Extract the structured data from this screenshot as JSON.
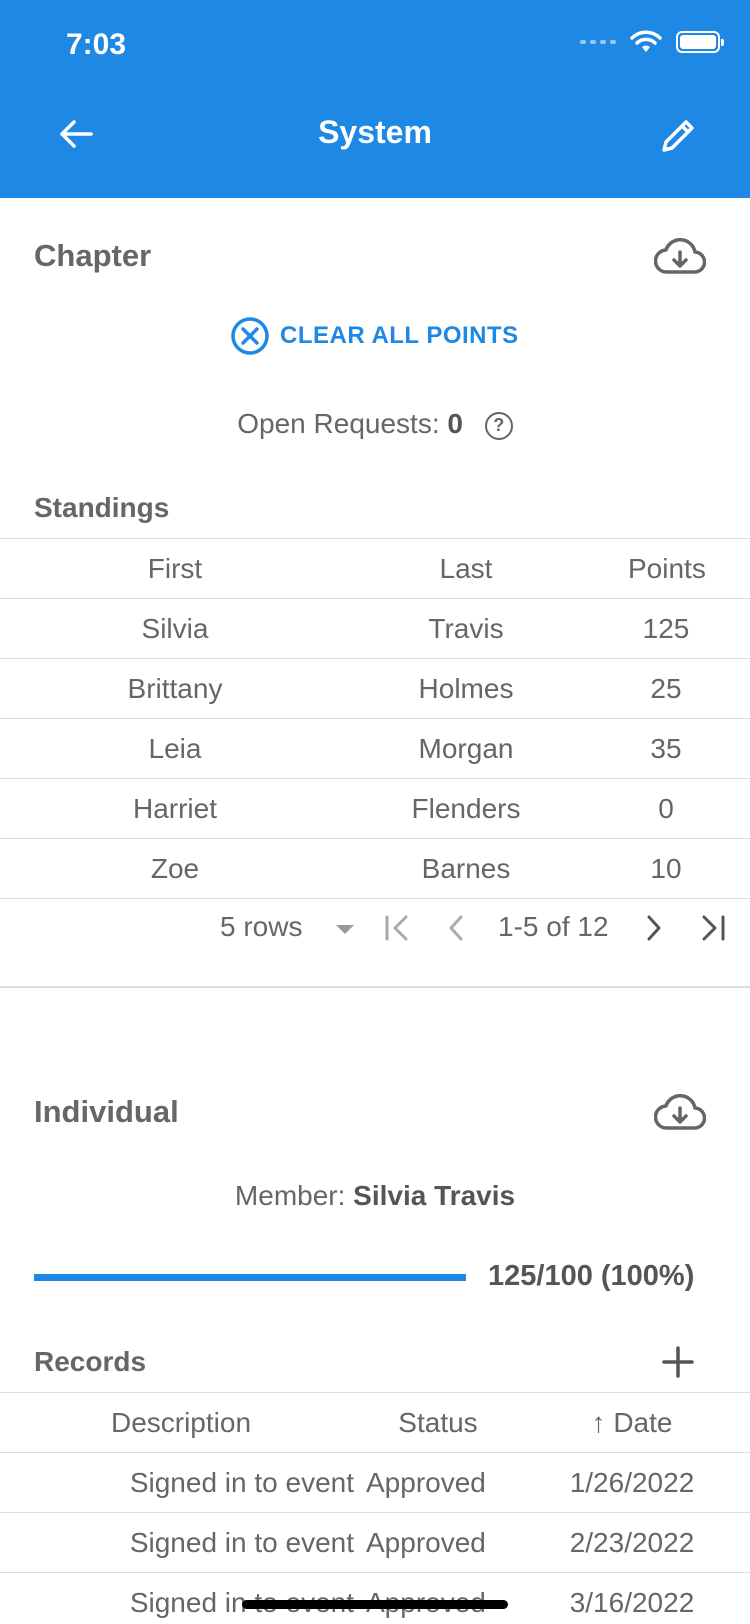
{
  "status_bar": {
    "time": "7:03"
  },
  "header": {
    "title": "System",
    "back_icon": "arrow-left-icon",
    "edit_icon": "pencil-icon"
  },
  "chapter": {
    "title": "Chapter",
    "download_icon": "cloud-download-icon",
    "clear_label": "CLEAR ALL POINTS",
    "open_requests_label": "Open Requests:",
    "open_requests_count": "0",
    "help_icon": "?",
    "standings_label": "Standings",
    "columns": [
      "First",
      "Last",
      "Points"
    ],
    "rows": [
      [
        "Silvia",
        "Travis",
        "125"
      ],
      [
        "Brittany",
        "Holmes",
        "25"
      ],
      [
        "Leia",
        "Morgan",
        "35"
      ],
      [
        "Harriet",
        "Flenders",
        "0"
      ],
      [
        "Zoe",
        "Barnes",
        "10"
      ]
    ],
    "pager": {
      "rows_per_page": "5 rows",
      "range": "1-5 of 12"
    }
  },
  "individual": {
    "title": "Individual",
    "download_icon": "cloud-download-icon",
    "member_label": "Member:",
    "member_name": "Silvia Travis",
    "progress_fraction": 1.0,
    "progress_label": "125/100 (100%)",
    "records_label": "Records",
    "columns": [
      "Description",
      "Status",
      "Date"
    ],
    "sort_indicator": "↑",
    "rows": [
      [
        "Signed in to event",
        "Approved",
        "1/26/2022"
      ],
      [
        "Signed in to event",
        "Approved",
        "2/23/2022"
      ],
      [
        "Signed in to event",
        "Approved",
        "3/16/2022"
      ]
    ]
  },
  "colors": {
    "primary": "#1e88e5",
    "text": "#666666",
    "divider": "#dddddd"
  }
}
